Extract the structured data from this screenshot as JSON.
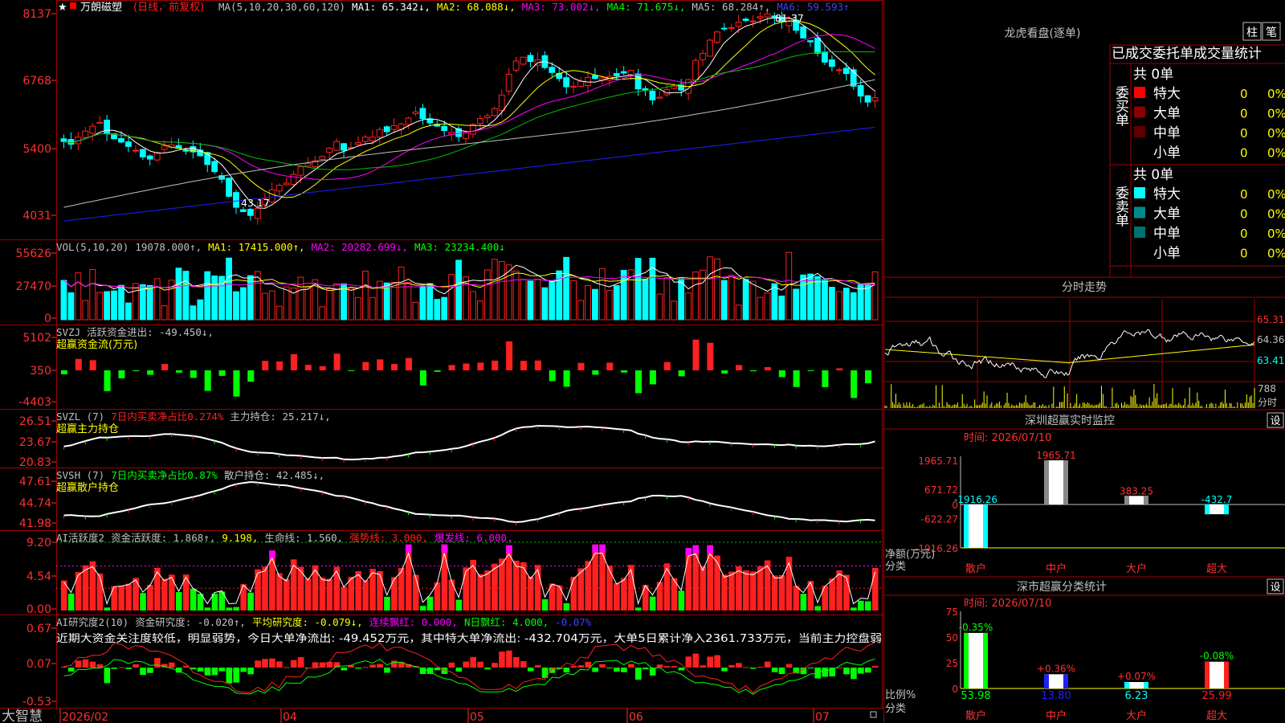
{
  "stock": {
    "name": "万朗磁塑",
    "mode": "(日线，前复权)"
  },
  "icons": {
    "star": "star-icon",
    "lock": "lock-icon"
  },
  "colors": {
    "up": "#ff2020",
    "down": "#00ffff",
    "ma1": "#ffffff",
    "ma2": "#ffff00",
    "ma3": "#ff00ff",
    "ma4": "#00c000",
    "ma5": "#c0c0c0",
    "ma6": "#2020ff",
    "grid": "#a00000"
  },
  "price_panel": {
    "legend": [
      {
        "text": "MA(5,10,20,30,60,120)",
        "color": "#c0c0c0"
      },
      {
        "text": "MA1: 65.342↓,",
        "color": "#ffffff"
      },
      {
        "text": "MA2: 68.088↓,",
        "color": "#ffff00"
      },
      {
        "text": "MA3: 73.002↓,",
        "color": "#ff00ff"
      },
      {
        "text": "MA4: 71.675↓,",
        "color": "#00ff00"
      },
      {
        "text": "MA5: 68.284↑,",
        "color": "#c0c0c0"
      },
      {
        "text": "MA6: 59.593↑",
        "color": "#4040ff"
      }
    ],
    "y_ticks": [
      "8137",
      "6768",
      "5400",
      "4031"
    ],
    "annot_high": "81.37",
    "annot_low": "43.17"
  },
  "vol_panel": {
    "legend": [
      {
        "text": "VOL(5,10,20)",
        "color": "#c0c0c0"
      },
      {
        "text": "19078.000↑,",
        "color": "#c0c0c0"
      },
      {
        "text": "MA1: 17415.000↑,",
        "color": "#ffff00"
      },
      {
        "text": "MA2: 20282.699↓,",
        "color": "#ff00ff"
      },
      {
        "text": "MA3: 23234.400↓",
        "color": "#00ff00"
      }
    ],
    "y_ticks": [
      "55626",
      "27470",
      "0"
    ]
  },
  "svzj_panel": {
    "legend": [
      {
        "text": "SVZJ",
        "color": "#c0c0c0"
      },
      {
        "text": "活跃资金进出: -49.450↓,",
        "color": "#c0c0c0"
      }
    ],
    "subtitle": "超赢资金流(万元)",
    "y_ticks": [
      "5102",
      "350",
      "-4403"
    ]
  },
  "svzl_panel": {
    "legend": [
      {
        "text": "SVZL (7)",
        "color": "#c0c0c0"
      },
      {
        "text": "7日内买卖净占比0.274%",
        "color": "#ff2020"
      },
      {
        "text": "主力持仓: 25.217↓,",
        "color": "#c0c0c0"
      }
    ],
    "subtitle": "超赢主力持仓",
    "y_ticks": [
      "26.51",
      "23.67",
      "20.83"
    ]
  },
  "svsh_panel": {
    "legend": [
      {
        "text": "SVSH (7)",
        "color": "#c0c0c0"
      },
      {
        "text": "7日内买卖净占比0.87%",
        "color": "#00ff00"
      },
      {
        "text": "散户持仓: 42.485↓,",
        "color": "#c0c0c0"
      }
    ],
    "subtitle": "超赢散户持仓",
    "y_ticks": [
      "47.61",
      "44.74",
      "41.98"
    ]
  },
  "ai_active_panel": {
    "legend": [
      {
        "text": "AI活跃度2",
        "color": "#c0c0c0"
      },
      {
        "text": "资金活跃度: 1.868↑,",
        "color": "#c0c0c0"
      },
      {
        "text": "9.198,",
        "color": "#ffff00"
      },
      {
        "text": "生命线: 1.560,",
        "color": "#c0c0c0"
      },
      {
        "text": "强势线: 3.000,",
        "color": "#ff2020"
      },
      {
        "text": "爆发线: 6.000,",
        "color": "#ff00ff"
      }
    ],
    "y_ticks": [
      "9.20",
      "4.54",
      "0.00"
    ]
  },
  "ai_research_panel": {
    "legend": [
      {
        "text": "AI研究度2(10)",
        "color": "#c0c0c0"
      },
      {
        "text": "资金研究度: -0.020↑,",
        "color": "#c0c0c0"
      },
      {
        "text": "平均研究度: -0.079↓,",
        "color": "#ffff00"
      },
      {
        "text": "连续飘红: 0.000,",
        "color": "#ff00ff"
      },
      {
        "text": "N日飘红: 4.000,",
        "color": "#00ff00"
      },
      {
        "text": "-0.07%",
        "color": "#4040ff"
      }
    ],
    "comment": "近期大资金关注度较低，明显弱势，今日大单净流出: -49.452万元，其中特大单净流出: -432.704万元，大单5日累计净入2361.733万元，当前主力控盘弱",
    "y_ticks": [
      "0.67",
      "0.07",
      "-0.53"
    ]
  },
  "x_axis": {
    "brand": "大智慧",
    "labels": [
      "2026/02",
      "04",
      "05",
      "06",
      "07"
    ]
  },
  "right": {
    "lhb_title": "龙虎看盘(逐单)",
    "tab_bar": "柱",
    "tab_detail": "笔",
    "order_title": "已成交委托单成交量统计",
    "buy_group": {
      "label": "委买单",
      "total": "共 0单",
      "rows": [
        {
          "name": "特大",
          "count": "0",
          "pct": "0%",
          "color": "#ff0000"
        },
        {
          "name": "大单",
          "count": "0",
          "pct": "0%",
          "color": "#8b0000"
        },
        {
          "name": "中单",
          "count": "0",
          "pct": "0%",
          "color": "#600000"
        },
        {
          "name": "小单",
          "count": "0",
          "pct": "0%",
          "color": ""
        }
      ]
    },
    "sell_group": {
      "label": "委卖单",
      "total": "共 0单",
      "rows": [
        {
          "name": "特大",
          "count": "0",
          "pct": "0%",
          "color": "#00ffff"
        },
        {
          "name": "大单",
          "count": "0",
          "pct": "0%",
          "color": "#008b8b"
        },
        {
          "name": "中单",
          "count": "0",
          "pct": "0%",
          "color": "#007070"
        },
        {
          "name": "小单",
          "count": "0",
          "pct": "0%",
          "color": ""
        }
      ]
    },
    "intraday": {
      "title": "分时走势",
      "y_ticks": [
        "65.31",
        "64.36",
        "63.41"
      ],
      "vol_ticks": [
        "788",
        "分时"
      ]
    },
    "monitor": {
      "title": "深圳超赢实时监控",
      "setting": "设",
      "date": "时间: 2026/07/10",
      "y_ticks": [
        "1965.71",
        "671.72",
        "0",
        "-622.27",
        "-1916.26"
      ],
      "ylabel": "净额(万元)",
      "xlabel": "分类",
      "bars": [
        {
          "category": "散户",
          "value": -1916.26,
          "label": "-1916.26"
        },
        {
          "category": "中户",
          "value": 1965.71,
          "label": "1965.71"
        },
        {
          "category": "大户",
          "value": 383.25,
          "label": "383.25"
        },
        {
          "category": "超大",
          "value": -432.7,
          "label": "-432.7"
        }
      ]
    },
    "classify": {
      "title": "深市超赢分类统计",
      "setting": "设",
      "date": "时间: 2026/07/10",
      "y_ticks": [
        "75",
        "50",
        "25",
        "0"
      ],
      "ylabel": "比例%",
      "xlabel": "分类",
      "bars": [
        {
          "category": "散户",
          "value": 53.98,
          "label": "53.98",
          "change": "-0.35%"
        },
        {
          "category": "中户",
          "value": 13.8,
          "label": "13.80",
          "change": "+0.36%"
        },
        {
          "category": "大户",
          "value": 6.23,
          "label": "6.23",
          "change": "+0.07%"
        },
        {
          "category": "超大",
          "value": 25.99,
          "label": "25.99",
          "change": "-0.08%"
        }
      ]
    }
  },
  "chart_data": [
    {
      "type": "candlestick",
      "title": "万朗磁塑 日线",
      "x": [
        "2026/02",
        "04",
        "05",
        "06",
        "07"
      ],
      "ylim": [
        40.31,
        81.37
      ],
      "close": [
        57.0,
        56.5,
        57.8,
        58.9,
        59.8,
        60.5,
        58.4,
        57.5,
        56.9,
        56.1,
        55.4,
        54.2,
        53.8,
        55.0,
        56.2,
        56.4,
        55.8,
        55.3,
        55.1,
        54.4,
        52.8,
        51.5,
        50.1,
        47.0,
        45.0,
        44.2,
        43.5,
        44.8,
        46.5,
        48.2,
        49.0,
        49.4,
        51.0,
        52.4,
        53.0,
        53.5,
        54.3,
        55.8,
        57.0,
        55.4,
        55.9,
        56.8,
        57.8,
        57.8,
        59.2,
        58.8,
        59.9,
        60.2,
        61.3,
        62.4,
        61.2,
        60.4,
        59.8,
        59.0,
        58.7,
        57.9,
        58.6,
        60.1,
        61.2,
        61.7,
        63.0,
        65.5,
        69.3,
        71.7,
        72.4,
        71.6,
        71.9,
        70.5,
        69.6,
        68.5,
        67.0,
        67.1,
        68.0,
        68.7,
        68.5,
        68.6,
        68.9,
        69.0,
        69.5,
        70.0,
        66.6,
        66.4,
        64.6,
        65.1,
        66.5,
        67.1,
        66.4,
        68.3,
        71.8,
        73.1,
        75.5,
        77.0,
        77.6,
        77.8,
        78.8,
        79.1,
        79.0,
        79.8,
        80.3,
        79.6,
        78.9,
        79.4,
        77.3,
        75.9,
        75.2,
        73.1,
        71.5,
        70.7,
        70.1,
        69.4,
        67.1,
        65.3,
        64.2,
        65.0
      ]
    },
    {
      "type": "bar",
      "title": "VOL",
      "ylim": [
        0,
        55626
      ],
      "series": "vol"
    },
    {
      "type": "bar",
      "title": "SVZJ",
      "ylim": [
        -4403,
        5102
      ],
      "series": "svzj"
    },
    {
      "type": "line",
      "title": "SVZL",
      "ylim": [
        20.83,
        26.51
      ]
    },
    {
      "type": "line",
      "title": "SVSH",
      "ylim": [
        41.98,
        47.61
      ]
    },
    {
      "type": "bar",
      "title": "AI活跃度2",
      "ylim": [
        0,
        9.2
      ]
    },
    {
      "type": "bar",
      "title": "AI研究度2(10)",
      "ylim": [
        -0.53,
        0.67
      ]
    },
    {
      "type": "bar",
      "title": "深圳超赢实时监控",
      "categories": [
        "散户",
        "中户",
        "大户",
        "超大"
      ],
      "values": [
        -1916.26,
        1965.71,
        383.25,
        -432.7
      ],
      "ylim": [
        -1916.26,
        1965.71
      ]
    },
    {
      "type": "bar",
      "title": "深市超赢分类统计",
      "categories": [
        "散户",
        "中户",
        "大户",
        "超大"
      ],
      "values": [
        53.98,
        13.8,
        6.23,
        25.99
      ],
      "ylim": [
        0,
        75
      ]
    }
  ]
}
